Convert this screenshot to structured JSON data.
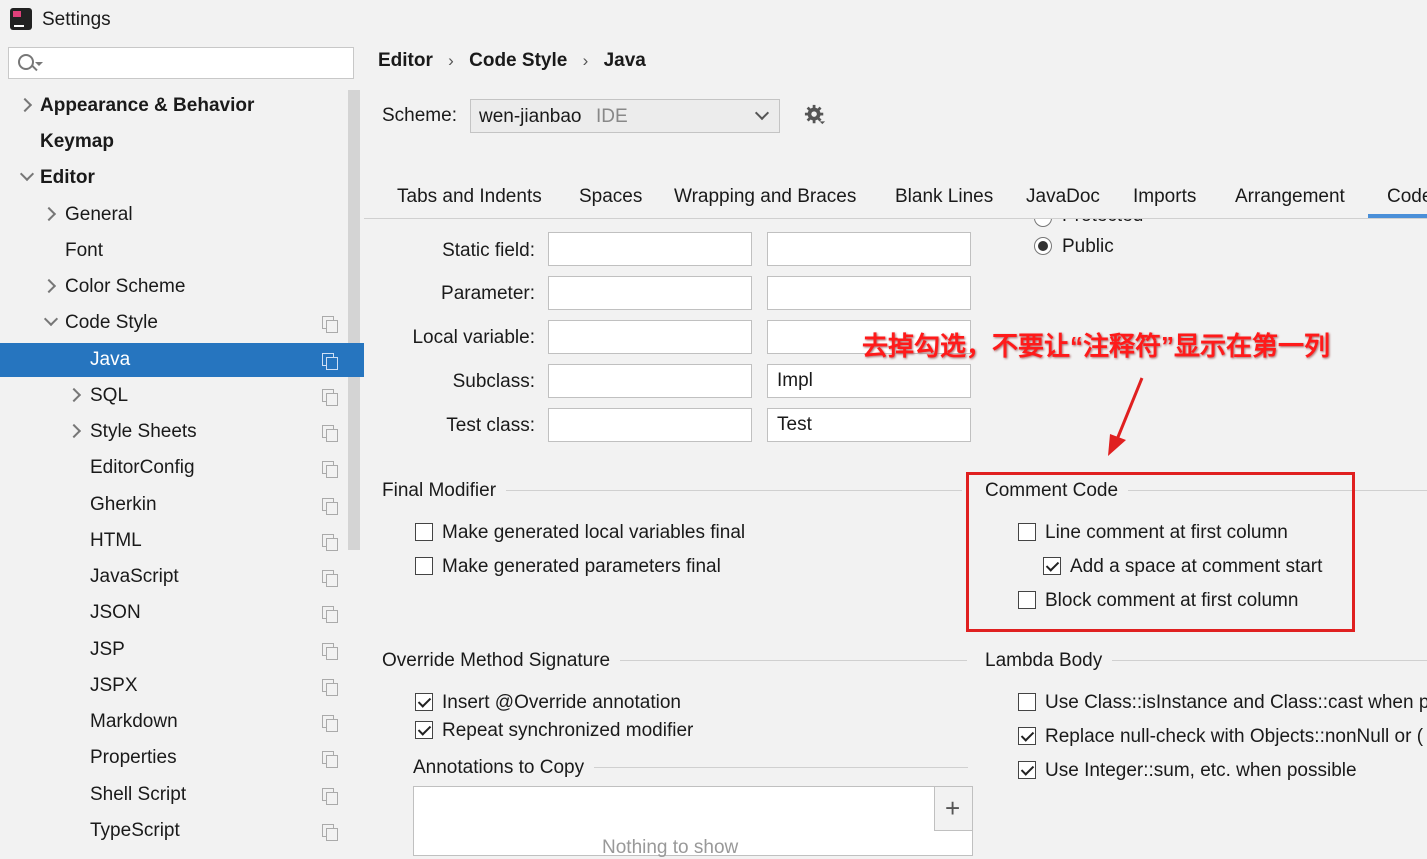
{
  "window": {
    "title": "Settings"
  },
  "sidebar": {
    "search_placeholder": "",
    "items": [
      {
        "label": "Appearance & Behavior"
      },
      {
        "label": "Keymap"
      },
      {
        "label": "Editor"
      },
      {
        "label": "General"
      },
      {
        "label": "Font"
      },
      {
        "label": "Color Scheme"
      },
      {
        "label": "Code Style"
      },
      {
        "label": "Java"
      },
      {
        "label": "SQL"
      },
      {
        "label": "Style Sheets"
      },
      {
        "label": "EditorConfig"
      },
      {
        "label": "Gherkin"
      },
      {
        "label": "HTML"
      },
      {
        "label": "JavaScript"
      },
      {
        "label": "JSON"
      },
      {
        "label": "JSP"
      },
      {
        "label": "JSPX"
      },
      {
        "label": "Markdown"
      },
      {
        "label": "Properties"
      },
      {
        "label": "Shell Script"
      },
      {
        "label": "TypeScript"
      }
    ]
  },
  "breadcrumb": [
    "Editor",
    "Code Style",
    "Java"
  ],
  "breadcrumb_sep": "›",
  "scheme": {
    "label": "Scheme:",
    "value": "wen-jianbao",
    "tag": "IDE"
  },
  "tabs": [
    "Tabs and Indents",
    "Spaces",
    "Wrapping and Braces",
    "Blank Lines",
    "JavaDoc",
    "Imports",
    "Arrangement",
    "Code"
  ],
  "naming": {
    "rows": [
      {
        "label": "Static field:",
        "prefix": "",
        "suffix": ""
      },
      {
        "label": "Parameter:",
        "prefix": "",
        "suffix": ""
      },
      {
        "label": "Local variable:",
        "prefix": "",
        "suffix": ""
      },
      {
        "label": "Subclass:",
        "prefix": "",
        "suffix": "Impl"
      },
      {
        "label": "Test class:",
        "prefix": "",
        "suffix": "Test"
      }
    ]
  },
  "visibility": {
    "partial": "Protected",
    "public": "Public"
  },
  "final_modifier": {
    "title": "Final Modifier",
    "options": [
      {
        "label": "Make generated local variables final",
        "checked": false
      },
      {
        "label": "Make generated parameters final",
        "checked": false
      }
    ]
  },
  "comment_code": {
    "title": "Comment Code",
    "options": [
      {
        "label": "Line comment at first column",
        "checked": false
      },
      {
        "label": "Add a space at comment start",
        "checked": true
      },
      {
        "label": "Block comment at first column",
        "checked": false
      }
    ]
  },
  "override": {
    "title": "Override Method Signature",
    "options": [
      {
        "label": "Insert @Override annotation",
        "checked": true
      },
      {
        "label": "Repeat synchronized modifier",
        "checked": true
      }
    ]
  },
  "annotations_copy": {
    "title": "Annotations to Copy",
    "empty_text": "Nothing to show",
    "add": "+"
  },
  "lambda": {
    "title": "Lambda Body",
    "options": [
      {
        "label": "Use Class::isInstance and Class::cast when pos",
        "checked": false
      },
      {
        "label": "Replace null-check with Objects::nonNull or (",
        "checked": true
      },
      {
        "label": "Use Integer::sum, etc. when possible",
        "checked": true
      }
    ]
  },
  "annotation_note": "去掉勾选，不要让“注释符”显示在第一列",
  "colors": {
    "selection": "#2675bf",
    "annotation": "#e02020",
    "tab_active": "#4a8fd8"
  }
}
